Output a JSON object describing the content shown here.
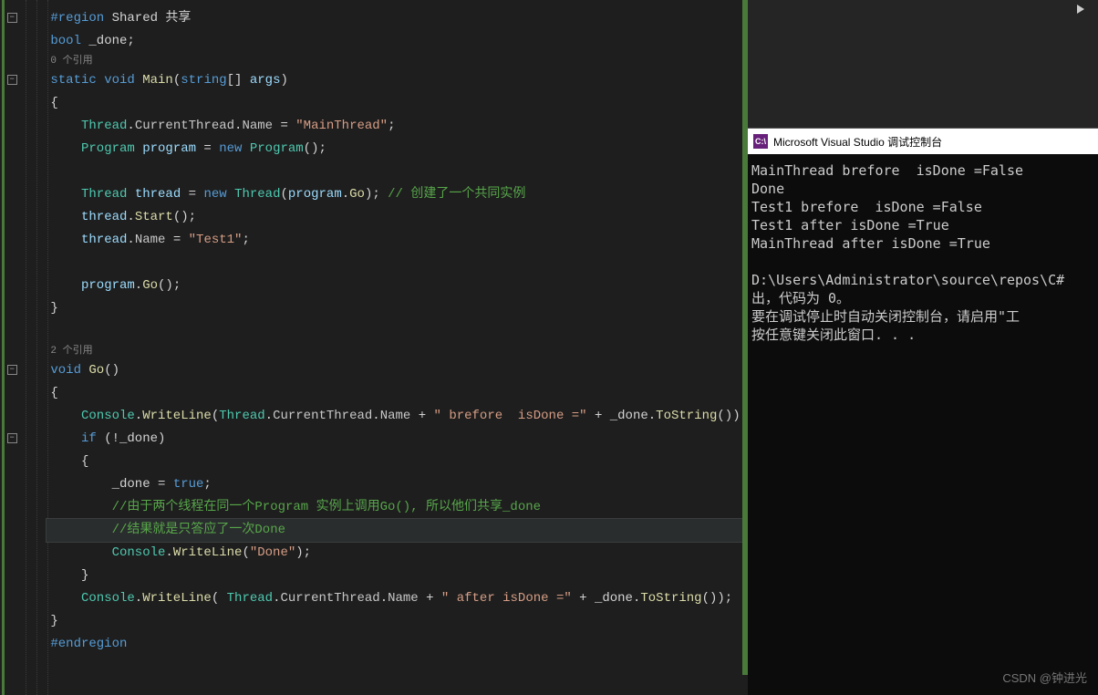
{
  "editor": {
    "lines": [
      {
        "ind": 0,
        "segs": [
          {
            "t": "#region",
            "c": "kw"
          },
          {
            "t": " Shared 共享",
            "c": "punct"
          }
        ]
      },
      {
        "ind": 0,
        "segs": [
          {
            "t": "bool",
            "c": "kw"
          },
          {
            "t": " _done;",
            "c": "punct"
          }
        ]
      },
      {
        "ind": 0,
        "hint": "0 个引用"
      },
      {
        "ind": 0,
        "segs": [
          {
            "t": "static",
            "c": "kw"
          },
          {
            "t": " ",
            "c": "punct"
          },
          {
            "t": "void",
            "c": "kw"
          },
          {
            "t": " ",
            "c": "punct"
          },
          {
            "t": "Main",
            "c": "method"
          },
          {
            "t": "(",
            "c": "punct"
          },
          {
            "t": "string",
            "c": "kw"
          },
          {
            "t": "[] ",
            "c": "punct"
          },
          {
            "t": "args",
            "c": "local"
          },
          {
            "t": ")",
            "c": "punct"
          }
        ]
      },
      {
        "ind": 0,
        "segs": [
          {
            "t": "{",
            "c": "punct"
          }
        ]
      },
      {
        "ind": 1,
        "segs": [
          {
            "t": "Thread",
            "c": "type"
          },
          {
            "t": ".",
            "c": "punct"
          },
          {
            "t": "CurrentThread",
            "c": "field"
          },
          {
            "t": ".",
            "c": "punct"
          },
          {
            "t": "Name",
            "c": "field"
          },
          {
            "t": " = ",
            "c": "punct"
          },
          {
            "t": "\"MainThread\"",
            "c": "str"
          },
          {
            "t": ";",
            "c": "punct"
          }
        ]
      },
      {
        "ind": 1,
        "segs": [
          {
            "t": "Program",
            "c": "type"
          },
          {
            "t": " ",
            "c": "punct"
          },
          {
            "t": "program",
            "c": "local"
          },
          {
            "t": " = ",
            "c": "punct"
          },
          {
            "t": "new",
            "c": "kw"
          },
          {
            "t": " ",
            "c": "punct"
          },
          {
            "t": "Program",
            "c": "type"
          },
          {
            "t": "();",
            "c": "punct"
          }
        ]
      },
      {
        "ind": 1,
        "segs": [
          {
            "t": "",
            "c": "punct"
          }
        ]
      },
      {
        "ind": 1,
        "segs": [
          {
            "t": "Thread",
            "c": "type"
          },
          {
            "t": " ",
            "c": "punct"
          },
          {
            "t": "thread",
            "c": "local"
          },
          {
            "t": " = ",
            "c": "punct"
          },
          {
            "t": "new",
            "c": "kw"
          },
          {
            "t": " ",
            "c": "punct"
          },
          {
            "t": "Thread",
            "c": "type"
          },
          {
            "t": "(",
            "c": "punct"
          },
          {
            "t": "program",
            "c": "local"
          },
          {
            "t": ".",
            "c": "punct"
          },
          {
            "t": "Go",
            "c": "method"
          },
          {
            "t": "); ",
            "c": "punct"
          },
          {
            "t": "// 创建了一个共同实例",
            "c": "comment"
          }
        ]
      },
      {
        "ind": 1,
        "segs": [
          {
            "t": "thread",
            "c": "local"
          },
          {
            "t": ".",
            "c": "punct"
          },
          {
            "t": "Start",
            "c": "method"
          },
          {
            "t": "();",
            "c": "punct"
          }
        ]
      },
      {
        "ind": 1,
        "segs": [
          {
            "t": "thread",
            "c": "local"
          },
          {
            "t": ".",
            "c": "punct"
          },
          {
            "t": "Name",
            "c": "field"
          },
          {
            "t": " = ",
            "c": "punct"
          },
          {
            "t": "\"Test1\"",
            "c": "str"
          },
          {
            "t": ";",
            "c": "punct"
          }
        ]
      },
      {
        "ind": 1,
        "segs": [
          {
            "t": "",
            "c": "punct"
          }
        ]
      },
      {
        "ind": 1,
        "segs": [
          {
            "t": "program",
            "c": "local"
          },
          {
            "t": ".",
            "c": "punct"
          },
          {
            "t": "Go",
            "c": "method"
          },
          {
            "t": "();",
            "c": "punct"
          }
        ]
      },
      {
        "ind": 0,
        "segs": [
          {
            "t": "}",
            "c": "punct"
          }
        ]
      },
      {
        "ind": 0,
        "segs": [
          {
            "t": "",
            "c": "punct"
          }
        ]
      },
      {
        "ind": 0,
        "hint": "2 个引用"
      },
      {
        "ind": 0,
        "segs": [
          {
            "t": "void",
            "c": "kw"
          },
          {
            "t": " ",
            "c": "punct"
          },
          {
            "t": "Go",
            "c": "method"
          },
          {
            "t": "()",
            "c": "punct"
          }
        ]
      },
      {
        "ind": 0,
        "segs": [
          {
            "t": "{",
            "c": "punct"
          }
        ]
      },
      {
        "ind": 1,
        "segs": [
          {
            "t": "Console",
            "c": "type"
          },
          {
            "t": ".",
            "c": "punct"
          },
          {
            "t": "WriteLine",
            "c": "method"
          },
          {
            "t": "(",
            "c": "punct"
          },
          {
            "t": "Thread",
            "c": "type"
          },
          {
            "t": ".",
            "c": "punct"
          },
          {
            "t": "CurrentThread",
            "c": "field"
          },
          {
            "t": ".",
            "c": "punct"
          },
          {
            "t": "Name",
            "c": "field"
          },
          {
            "t": " + ",
            "c": "punct"
          },
          {
            "t": "\" brefore  isDone =\"",
            "c": "str"
          },
          {
            "t": " + _done.",
            "c": "punct"
          },
          {
            "t": "ToString",
            "c": "method"
          },
          {
            "t": "());",
            "c": "punct"
          }
        ]
      },
      {
        "ind": 1,
        "segs": [
          {
            "t": "if",
            "c": "kw"
          },
          {
            "t": " (!_done)",
            "c": "punct"
          }
        ]
      },
      {
        "ind": 1,
        "segs": [
          {
            "t": "{",
            "c": "punct"
          }
        ]
      },
      {
        "ind": 2,
        "segs": [
          {
            "t": "_done = ",
            "c": "punct"
          },
          {
            "t": "true",
            "c": "kw"
          },
          {
            "t": ";",
            "c": "punct"
          }
        ]
      },
      {
        "ind": 2,
        "segs": [
          {
            "t": "//由于两个线程在同一个Program 实例上调用Go(), 所以他们共享_done",
            "c": "comment"
          }
        ]
      },
      {
        "ind": 2,
        "segs": [
          {
            "t": "//结果就是只答应了一次Done",
            "c": "comment"
          }
        ],
        "hl": true
      },
      {
        "ind": 2,
        "segs": [
          {
            "t": "Console",
            "c": "type"
          },
          {
            "t": ".",
            "c": "punct"
          },
          {
            "t": "WriteLine",
            "c": "method"
          },
          {
            "t": "(",
            "c": "punct"
          },
          {
            "t": "\"Done\"",
            "c": "str"
          },
          {
            "t": ");",
            "c": "punct"
          }
        ]
      },
      {
        "ind": 1,
        "segs": [
          {
            "t": "}",
            "c": "punct"
          }
        ]
      },
      {
        "ind": 1,
        "segs": [
          {
            "t": "Console",
            "c": "type"
          },
          {
            "t": ".",
            "c": "punct"
          },
          {
            "t": "WriteLine",
            "c": "method"
          },
          {
            "t": "( ",
            "c": "punct"
          },
          {
            "t": "Thread",
            "c": "type"
          },
          {
            "t": ".",
            "c": "punct"
          },
          {
            "t": "CurrentThread",
            "c": "field"
          },
          {
            "t": ".",
            "c": "punct"
          },
          {
            "t": "Name",
            "c": "field"
          },
          {
            "t": " + ",
            "c": "punct"
          },
          {
            "t": "\" after isDone =\"",
            "c": "str"
          },
          {
            "t": " + _done.",
            "c": "punct"
          },
          {
            "t": "ToString",
            "c": "method"
          },
          {
            "t": "());",
            "c": "punct"
          }
        ]
      },
      {
        "ind": 0,
        "segs": [
          {
            "t": "}",
            "c": "punct"
          }
        ]
      },
      {
        "ind": 0,
        "segs": [
          {
            "t": "#endregion",
            "c": "kw"
          }
        ]
      }
    ],
    "fold_positions": [
      0,
      3,
      16,
      19
    ]
  },
  "console": {
    "title": "Microsoft Visual Studio 调试控制台",
    "icon_text": "C:\\",
    "output": "MainThread brefore  isDone =False\nDone\nTest1 brefore  isDone =False\nTest1 after isDone =True\nMainThread after isDone =True\n\nD:\\Users\\Administrator\\source\\repos\\C#\n出，代码为 0。\n要在调试停止时自动关闭控制台，请启用\"工\n按任意键关闭此窗口. . ."
  },
  "watermark": "CSDN @钟进光"
}
